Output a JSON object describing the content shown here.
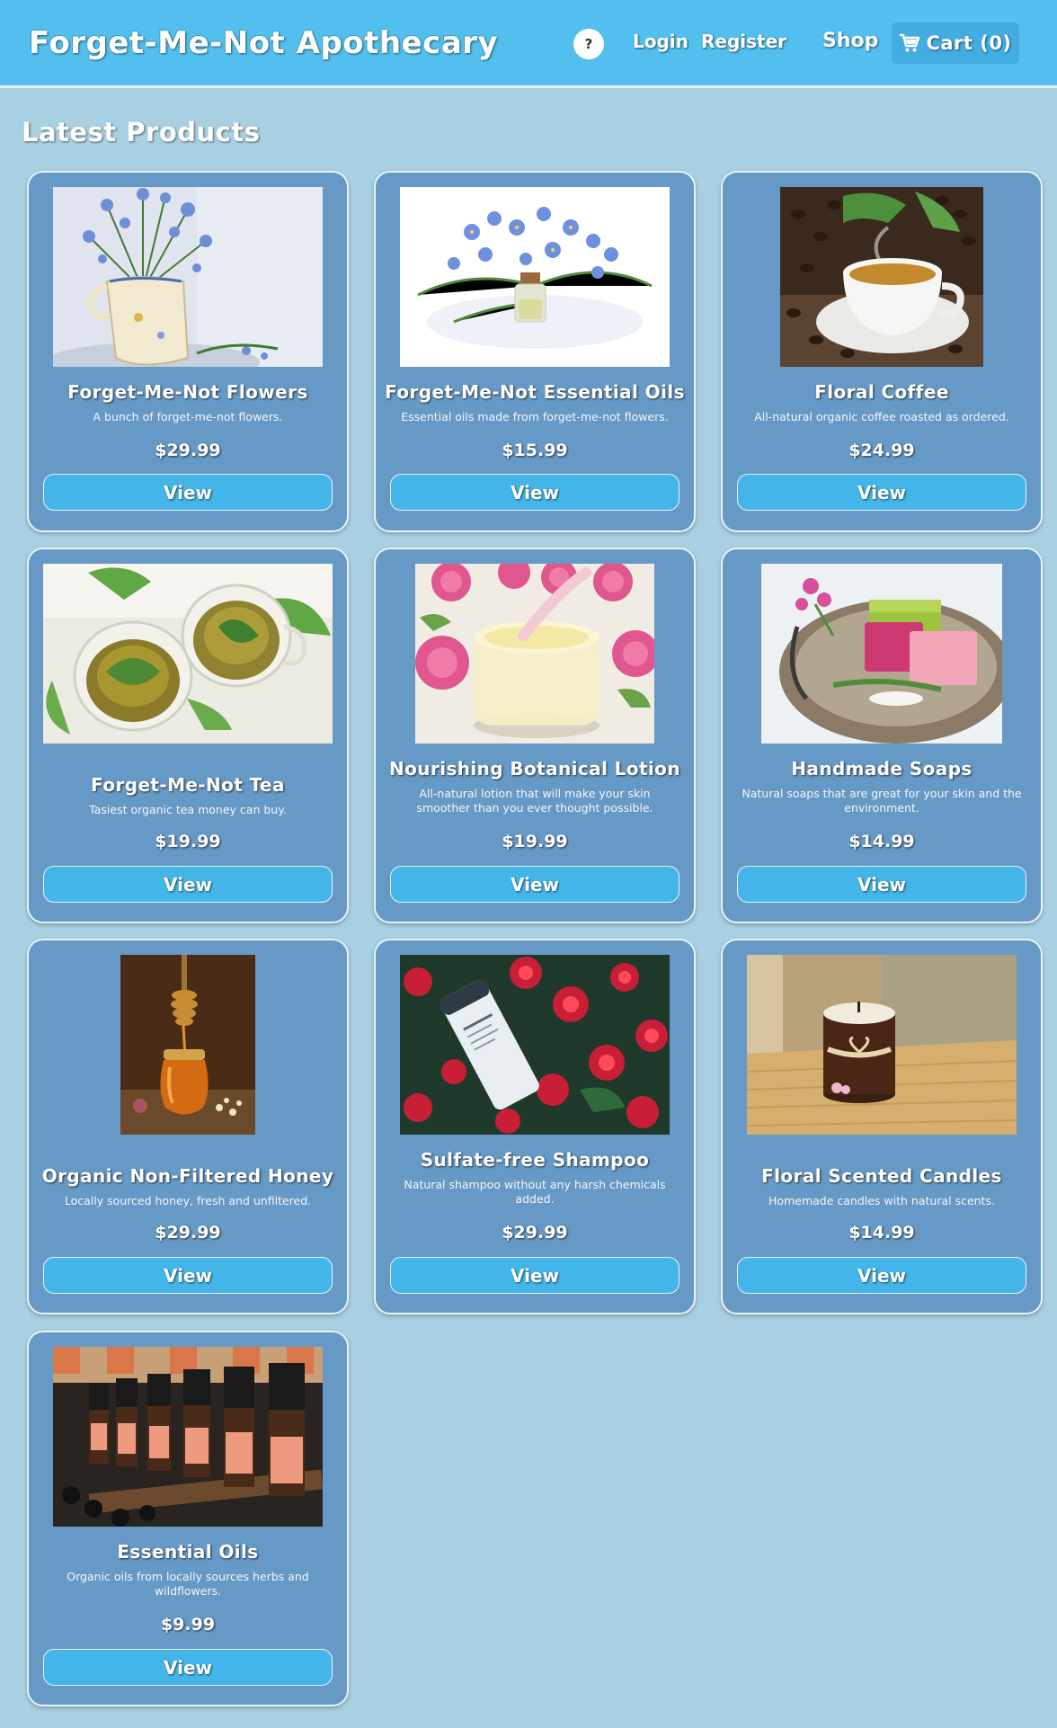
{
  "header": {
    "brand": "Forget-Me-Not Apothecary",
    "help_label": "?",
    "login_label": "Login",
    "register_label": "Register",
    "shop_label": "Shop",
    "cart_label": "Cart (0)"
  },
  "main": {
    "section_title": "Latest Products",
    "view_label": "View",
    "products": [
      {
        "name": "Forget-Me-Not Flowers",
        "description": "A bunch of forget-me-not flowers.",
        "price": "$29.99"
      },
      {
        "name": "Forget-Me-Not Essential Oils",
        "description": "Essential oils made from forget-me-not flowers.",
        "price": "$15.99"
      },
      {
        "name": "Floral Coffee",
        "description": "All-natural organic coffee roasted as ordered.",
        "price": "$24.99"
      },
      {
        "name": "Forget-Me-Not Tea",
        "description": "Tasiest organic tea money can buy.",
        "price": "$19.99"
      },
      {
        "name": "Nourishing Botanical Lotion",
        "description": "All-natural lotion that will make your skin smoother than you ever thought possible.",
        "price": "$19.99"
      },
      {
        "name": "Handmade Soaps",
        "description": "Natural soaps that are great for your skin and the environment.",
        "price": "$14.99"
      },
      {
        "name": "Organic Non-Filtered Honey",
        "description": "Locally sourced honey, fresh and unfiltered.",
        "price": "$29.99"
      },
      {
        "name": "Sulfate-free Shampoo",
        "description": "Natural shampoo without any harsh chemicals added.",
        "price": "$29.99"
      },
      {
        "name": "Floral Scented Candles",
        "description": "Homemade candles with natural scents.",
        "price": "$14.99"
      },
      {
        "name": "Essential Oils",
        "description": "Organic oils from locally sources herbs and wildflowers.",
        "price": "$9.99"
      }
    ]
  },
  "colors": {
    "page_bg": "#a8cfe2",
    "navbar_bg": "#52bfee",
    "card_bg": "#6799c6",
    "button_bg": "#43b5e9",
    "cart_bg": "#43ace0"
  }
}
